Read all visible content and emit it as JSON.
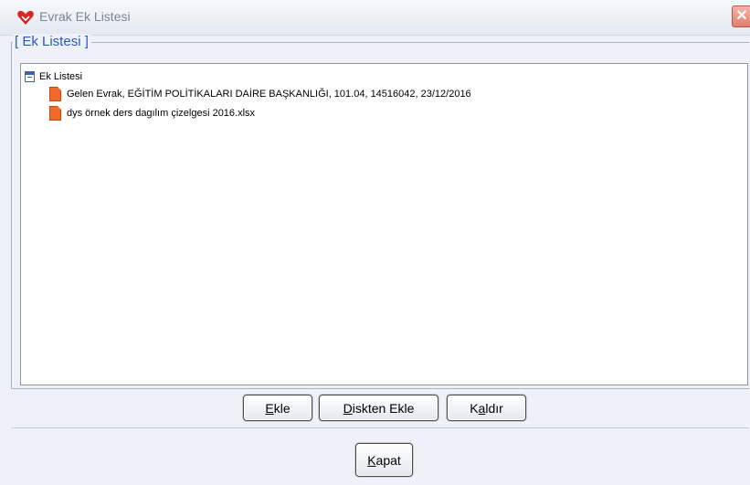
{
  "window": {
    "title": "Evrak Ek Listesi",
    "close_symbol": "✕"
  },
  "group": {
    "legend": "[ Ek Listesi ]"
  },
  "tree": {
    "root_label": "Ek Listesi",
    "root_icon": "list-document-icon",
    "item_icon": "orange-file-icon",
    "items": [
      {
        "label": "Gelen Evrak, EĞİTİM POLİTİKALARI DAİRE BAŞKANLIĞI, 101.04, 14516042, 23/12/2016"
      },
      {
        "label": "dys örnek ders dagılım çizelgesi 2016.xlsx"
      }
    ]
  },
  "buttons": {
    "add": {
      "mnemonic": "E",
      "rest": "kle"
    },
    "add_from_disk": {
      "mnemonic": "D",
      "rest": "iskten Ekle"
    },
    "remove": {
      "prefix": "K",
      "mnemonic": "a",
      "rest": "ldır"
    },
    "close": {
      "mnemonic": "K",
      "rest": "apat"
    }
  },
  "colors": {
    "legend_text": "#2d55c4",
    "file_icon": "#f26a2a",
    "close_button": "#e27e6d"
  }
}
